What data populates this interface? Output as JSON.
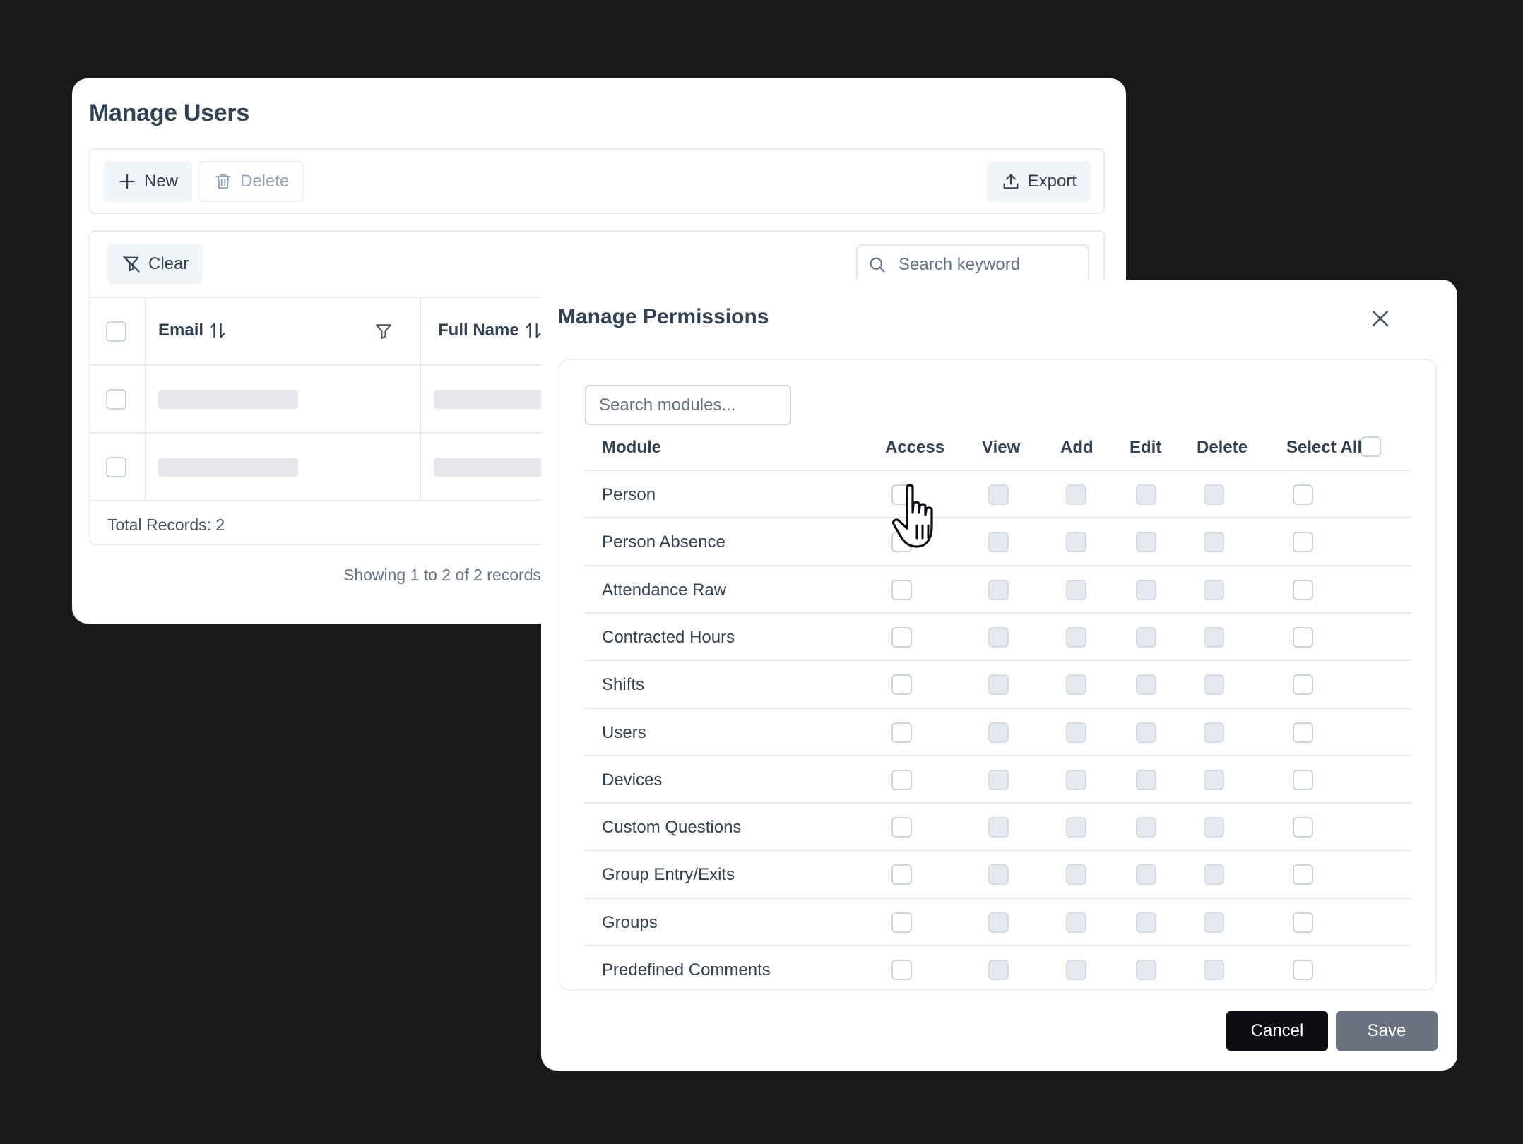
{
  "users_page": {
    "title": "Manage Users",
    "toolbar": {
      "new_label": "New",
      "delete_label": "Delete",
      "export_label": "Export"
    },
    "filters": {
      "clear_label": "Clear",
      "search_placeholder": "Search keyword"
    },
    "table": {
      "columns": [
        "Email",
        "Full Name"
      ],
      "total_records": "Total Records: 2"
    },
    "pagination_text": "Showing 1 to 2 of 2 records"
  },
  "permissions_modal": {
    "title": "Manage Permissions",
    "search_placeholder": "Search modules...",
    "columns": {
      "module": "Module",
      "access": "Access",
      "view": "View",
      "add": "Add",
      "edit": "Edit",
      "delete": "Delete",
      "select_all": "Select All"
    },
    "modules": [
      "Person",
      "Person Absence",
      "Attendance Raw",
      "Contracted Hours",
      "Shifts",
      "Users",
      "Devices",
      "Custom Questions",
      "Group Entry/Exits",
      "Groups",
      "Predefined Comments"
    ],
    "cancel_label": "Cancel",
    "save_label": "Save"
  },
  "colors": {
    "background": "#19191b",
    "cancel_button": "#0b0b12",
    "save_button": "#6b7280",
    "disabled_checkbox": "#e5e9ef"
  }
}
